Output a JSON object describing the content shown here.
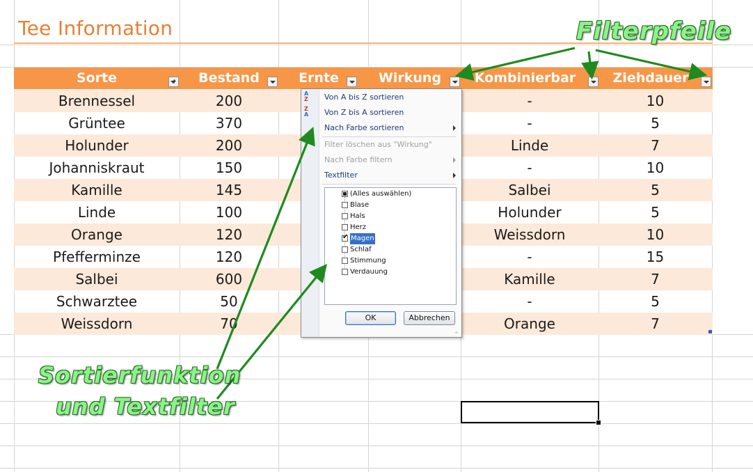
{
  "sheet": {
    "title": "Tee Information",
    "headers": [
      "Sorte",
      "Bestand",
      "Ernte",
      "Wirkung",
      "Kombinierbar",
      "Ziehdauer"
    ],
    "rows": [
      {
        "sorte": "Brennessel",
        "bestand": "200",
        "kombinierbar": "-",
        "ziehdauer": "10"
      },
      {
        "sorte": "Grüntee",
        "bestand": "370",
        "kombinierbar": "-",
        "ziehdauer": "5"
      },
      {
        "sorte": "Holunder",
        "bestand": "200",
        "kombinierbar": "Linde",
        "ziehdauer": "7"
      },
      {
        "sorte": "Johanniskraut",
        "bestand": "150",
        "kombinierbar": "-",
        "ziehdauer": "10"
      },
      {
        "sorte": "Kamille",
        "bestand": "145",
        "kombinierbar": "Salbei",
        "ziehdauer": "5"
      },
      {
        "sorte": "Linde",
        "bestand": "100",
        "kombinierbar": "Holunder",
        "ziehdauer": "5"
      },
      {
        "sorte": "Orange",
        "bestand": "120",
        "kombinierbar": "Weissdorn",
        "ziehdauer": "10"
      },
      {
        "sorte": "Pfefferminze",
        "bestand": "120",
        "kombinierbar": "-",
        "ziehdauer": "15"
      },
      {
        "sorte": "Salbei",
        "bestand": "600",
        "kombinierbar": "Kamille",
        "ziehdauer": "7"
      },
      {
        "sorte": "Schwarztee",
        "bestand": "50",
        "kombinierbar": "-",
        "ziehdauer": "5"
      },
      {
        "sorte": "Weissdorn",
        "bestand": "70",
        "kombinierbar": "Orange",
        "ziehdauer": "7"
      }
    ]
  },
  "filter_menu": {
    "sort_az": "Von A bis Z sortieren",
    "sort_za": "Von Z bis A sortieren",
    "sort_color": "Nach Farbe sortieren",
    "clear_filter": "Filter löschen aus \"Wirkung\"",
    "filter_color": "Nach Farbe filtern",
    "text_filter": "Textfilter",
    "items": [
      {
        "label": "(Alles auswählen)",
        "state": "partial"
      },
      {
        "label": "Blase",
        "state": "unchecked"
      },
      {
        "label": "Hals",
        "state": "unchecked"
      },
      {
        "label": "Herz",
        "state": "unchecked"
      },
      {
        "label": "Magen",
        "state": "checked"
      },
      {
        "label": "Schlaf",
        "state": "unchecked"
      },
      {
        "label": "Stimmung",
        "state": "unchecked"
      },
      {
        "label": "Verdauung",
        "state": "unchecked"
      }
    ],
    "ok_label": "OK",
    "cancel_label": "Abbrechen"
  },
  "annotations": {
    "filter_arrows": "Filterpfeile",
    "sort_line1": "Sortierfunktion",
    "sort_line2": "und Textfilter"
  },
  "colors": {
    "header": "#f79646",
    "band": "#fde9d9",
    "title": "#ed7d31",
    "annotation": "#8ef08a",
    "arrow": "#1f8a1f"
  }
}
